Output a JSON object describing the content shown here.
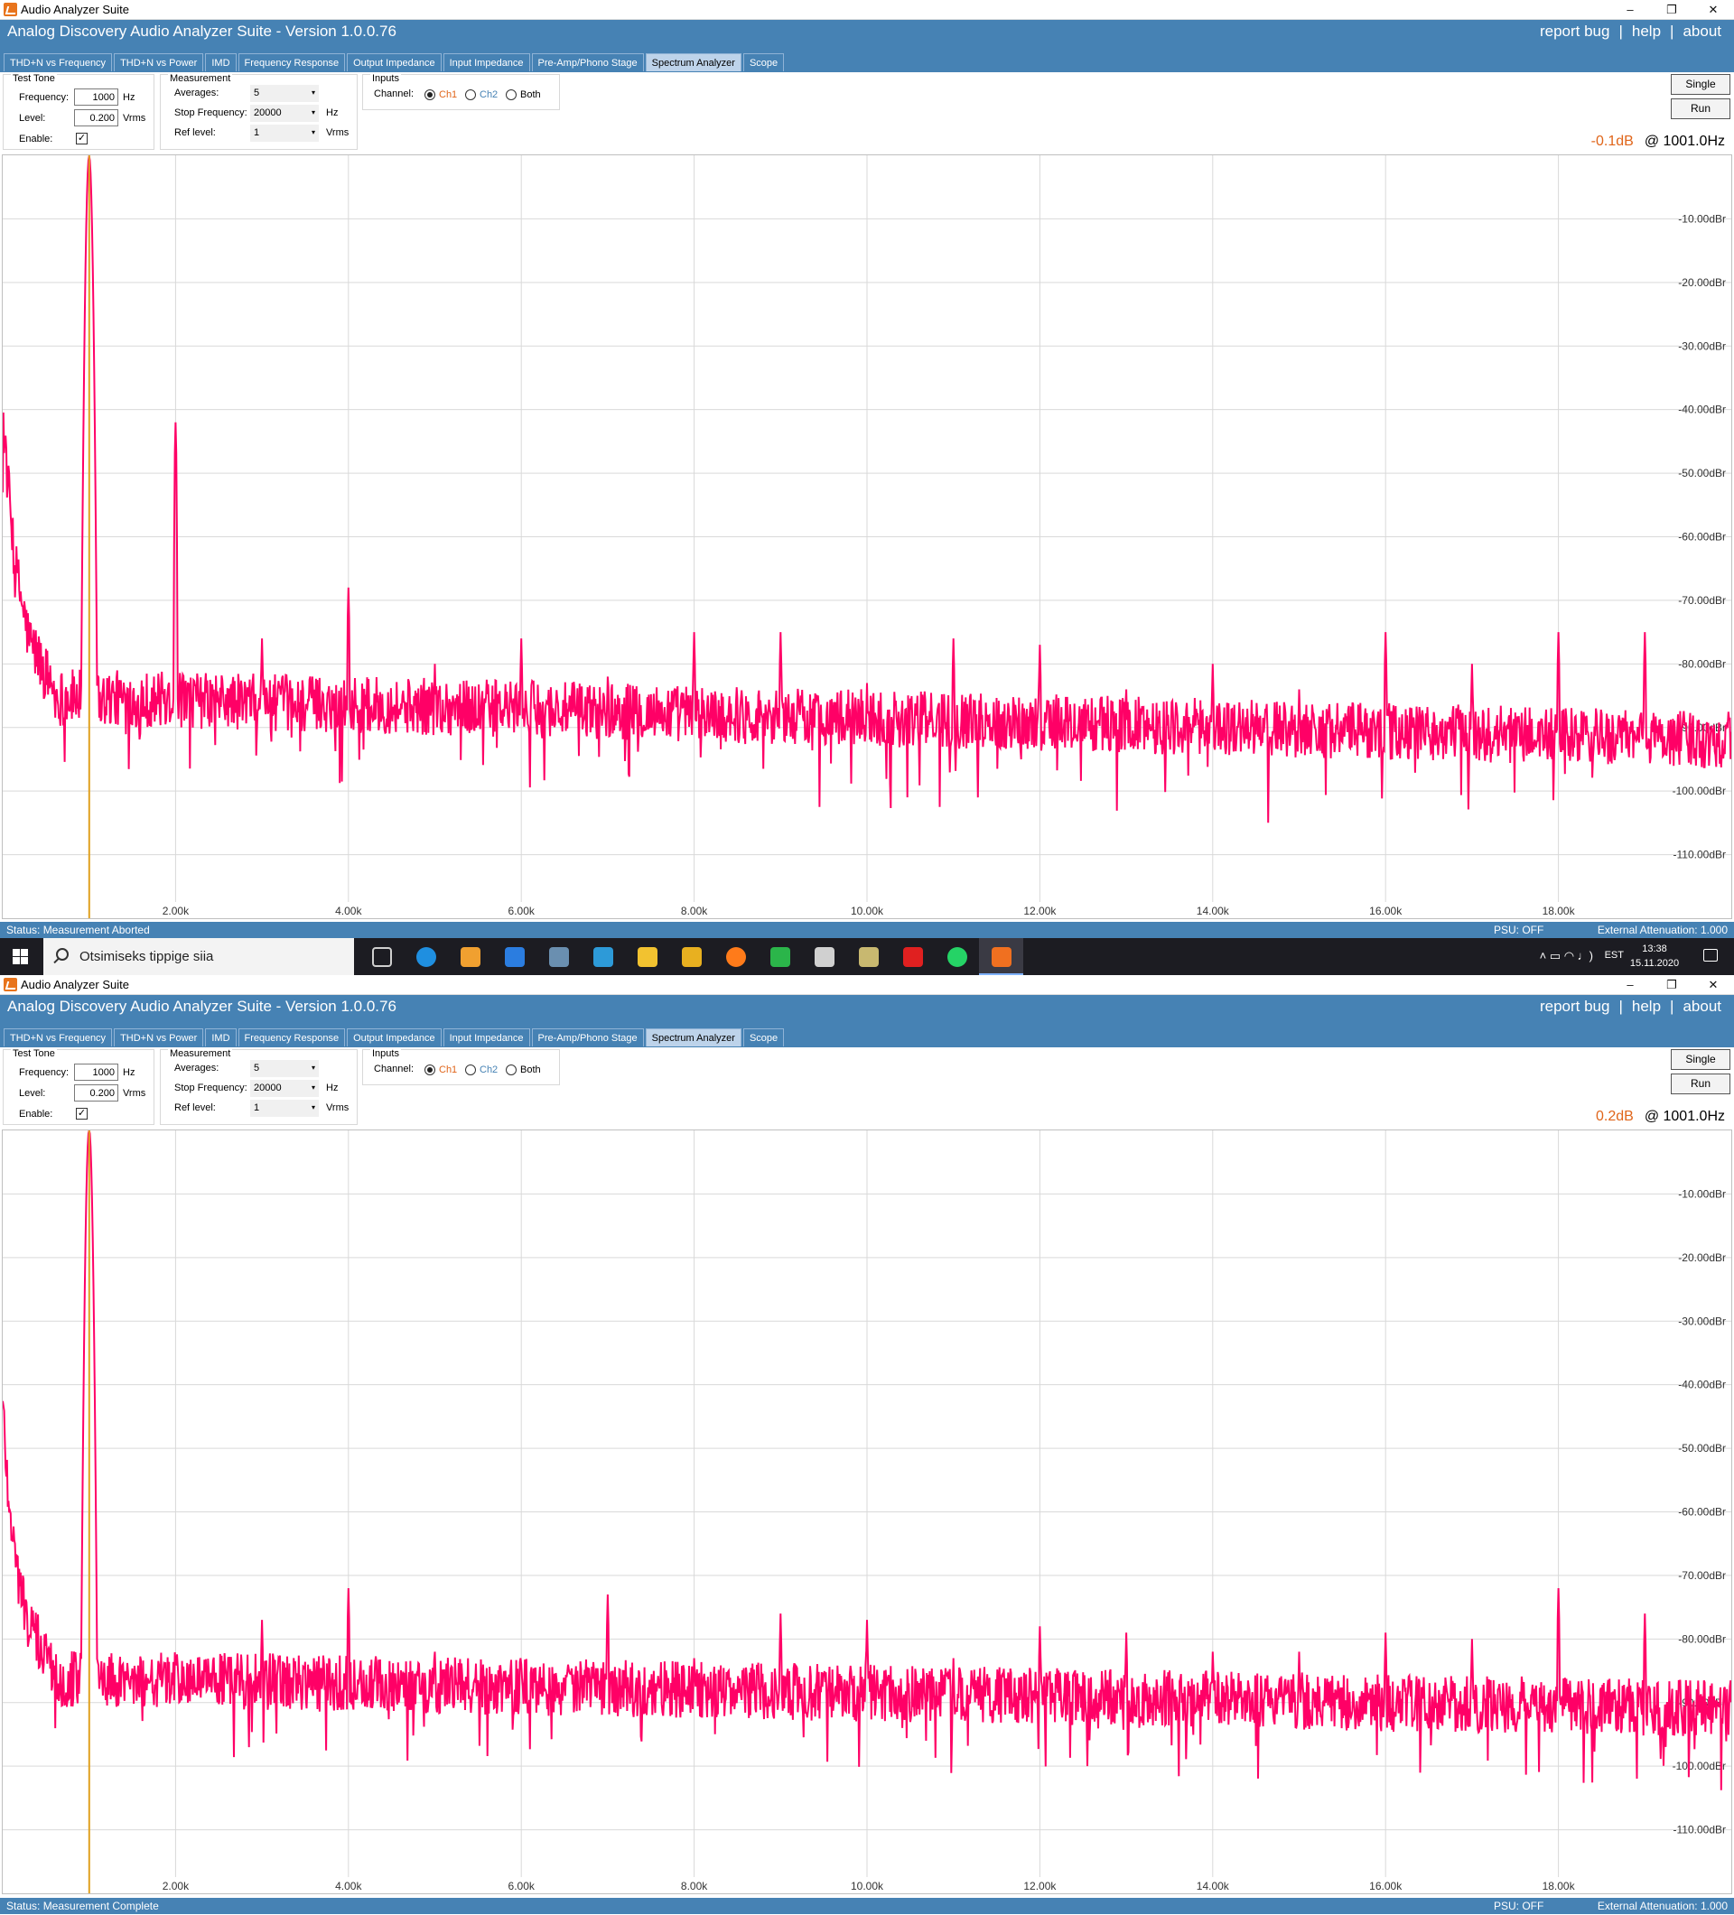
{
  "window": {
    "title": "Audio Analyzer Suite",
    "minimize": "–",
    "restore": "❐",
    "close": "✕"
  },
  "header": {
    "title": "Analog Discovery Audio Analyzer Suite - Version   1.0.0.76",
    "links": [
      "report bug",
      "help",
      "about"
    ],
    "separator": "|"
  },
  "tabs": [
    "THD+N vs Frequency",
    "THD+N vs Power",
    "IMD",
    "Frequency Response",
    "Output Impedance",
    "Input Impedance",
    "Pre-Amp/Phono Stage",
    "Spectrum Analyzer",
    "Scope"
  ],
  "active_tab": "Spectrum Analyzer",
  "test_tone": {
    "title": "Test Tone",
    "frequency_label": "Frequency:",
    "frequency_value": "1000",
    "frequency_unit": "Hz",
    "level_label": "Level:",
    "level_value": "0.200",
    "level_unit": "Vrms",
    "enable_label": "Enable:",
    "enable_checked": "✓"
  },
  "measurement": {
    "title": "Measurement",
    "averages_label": "Averages:",
    "averages_value": "5",
    "stop_label": "Stop Frequency:",
    "stop_value": "20000",
    "stop_unit": "Hz",
    "ref_label": "Ref level:",
    "ref_value": "1",
    "ref_unit": "Vrms",
    "arrow": "▾"
  },
  "inputs": {
    "title": "Inputs",
    "channel_label": "Channel:",
    "ch1": "Ch1",
    "ch2": "Ch2",
    "both": "Both",
    "selected": "Ch1"
  },
  "buttons": {
    "single": "Single",
    "run": "Run"
  },
  "colors": {
    "header": "#4682b4",
    "trace": "#ff0066",
    "marker": "#e0a020",
    "grid": "#d9d9d9",
    "readout_db": "#e0651a"
  },
  "panels": [
    {
      "readout_db": "-0.1dB",
      "readout_freq": "@ 1001.0Hz",
      "status": "Status: Measurement Aborted",
      "psu": "PSU: OFF",
      "attenuation": "External Attenuation: 1.000"
    },
    {
      "readout_db": "0.2dB",
      "readout_freq": "@ 1001.0Hz",
      "status": "Status: Measurement Complete",
      "psu": "PSU: OFF",
      "attenuation": "External Attenuation: 1.000"
    }
  ],
  "taskbar": {
    "search_placeholder": "Otsimiseks tippige siia",
    "icons": [
      "task-view-icon",
      "edge-icon",
      "store-icon",
      "mail-icon",
      "calculator-icon",
      "photos-icon",
      "file-explorer-icon",
      "paint-icon",
      "firefox-icon",
      "winamp-icon",
      "wolf-app-icon",
      "cpu-z-icon",
      "red-app-icon",
      "whatsapp-icon",
      "audio-analyzer-icon"
    ],
    "tray_glyphs": "˄  ▭  ◠  ♩)",
    "language": "EST",
    "time": "13:38",
    "date": "15.11.2020"
  },
  "chart_data": [
    {
      "type": "line",
      "title": "",
      "xlabel": "",
      "ylabel": "",
      "x_unit": "Hz",
      "xlim": [
        0,
        20000
      ],
      "ylim": [
        -120,
        0
      ],
      "x_ticks": [
        2000,
        4000,
        6000,
        8000,
        10000,
        12000,
        14000,
        16000,
        18000
      ],
      "x_tick_labels": [
        "2.00k",
        "4.00k",
        "6.00k",
        "8.00k",
        "10.00k",
        "12.00k",
        "14.00k",
        "16.00k",
        "18.00k"
      ],
      "y_ticks": [
        -10,
        -20,
        -30,
        -40,
        -50,
        -60,
        -70,
        -80,
        -90,
        -100,
        -110
      ],
      "y_tick_labels": [
        "-10.00dBr",
        "-20.00dBr",
        "-30.00dBr",
        "-40.00dBr",
        "-50.00dBr",
        "-60.00dBr",
        "-70.00dBr",
        "-80.00dBr",
        "-90.00dBr",
        "-100.00dBr",
        "-110.00dBr"
      ],
      "grid": true,
      "marker_frequency": 1001,
      "noise_floor": {
        "start_db": -85,
        "end_db": -92
      },
      "low_freq_rise": [
        [
          0,
          -40
        ],
        [
          60,
          -52
        ],
        [
          150,
          -65
        ],
        [
          300,
          -76
        ],
        [
          600,
          -84
        ]
      ],
      "peaks": [
        {
          "freq": 1000,
          "db": -0.1
        },
        {
          "freq": 2000,
          "db": -42
        },
        {
          "freq": 3000,
          "db": -76
        },
        {
          "freq": 4000,
          "db": -68
        },
        {
          "freq": 5000,
          "db": -80
        },
        {
          "freq": 6000,
          "db": -76
        },
        {
          "freq": 7000,
          "db": -82
        },
        {
          "freq": 8000,
          "db": -75
        },
        {
          "freq": 9000,
          "db": -75
        },
        {
          "freq": 10000,
          "db": -83
        },
        {
          "freq": 11000,
          "db": -76
        },
        {
          "freq": 12000,
          "db": -77
        },
        {
          "freq": 13000,
          "db": -84
        },
        {
          "freq": 14000,
          "db": -80
        },
        {
          "freq": 15000,
          "db": -84
        },
        {
          "freq": 16000,
          "db": -75
        },
        {
          "freq": 17000,
          "db": -80
        },
        {
          "freq": 18000,
          "db": -75
        },
        {
          "freq": 19000,
          "db": -75
        }
      ]
    },
    {
      "type": "line",
      "title": "",
      "xlabel": "",
      "ylabel": "",
      "x_unit": "Hz",
      "xlim": [
        0,
        20000
      ],
      "ylim": [
        -120,
        0
      ],
      "x_ticks": [
        2000,
        4000,
        6000,
        8000,
        10000,
        12000,
        14000,
        16000,
        18000
      ],
      "x_tick_labels": [
        "2.00k",
        "4.00k",
        "6.00k",
        "8.00k",
        "10.00k",
        "12.00k",
        "14.00k",
        "16.00k",
        "18.00k"
      ],
      "y_ticks": [
        -10,
        -20,
        -30,
        -40,
        -50,
        -60,
        -70,
        -80,
        -90,
        -100,
        -110
      ],
      "y_tick_labels": [
        "-10.00dBr",
        "-20.00dBr",
        "-30.00dBr",
        "-40.00dBr",
        "-50.00dBr",
        "-60.00dBr",
        "-70.00dBr",
        "-80.00dBr",
        "-90.00dBr",
        "-100.00dBr",
        "-110.00dBr"
      ],
      "grid": true,
      "marker_frequency": 1001,
      "noise_floor": {
        "start_db": -86,
        "end_db": -91
      },
      "low_freq_rise": [
        [
          0,
          -43
        ],
        [
          60,
          -56
        ],
        [
          150,
          -68
        ],
        [
          300,
          -78
        ],
        [
          600,
          -85
        ]
      ],
      "peaks": [
        {
          "freq": 1000,
          "db": 0.2
        },
        {
          "freq": 2000,
          "db": -84
        },
        {
          "freq": 3000,
          "db": -77
        },
        {
          "freq": 4000,
          "db": -72
        },
        {
          "freq": 5000,
          "db": -82
        },
        {
          "freq": 6000,
          "db": -84
        },
        {
          "freq": 7000,
          "db": -73
        },
        {
          "freq": 8000,
          "db": -83
        },
        {
          "freq": 9000,
          "db": -76
        },
        {
          "freq": 10000,
          "db": -77
        },
        {
          "freq": 11000,
          "db": -83
        },
        {
          "freq": 12000,
          "db": -78
        },
        {
          "freq": 13000,
          "db": -79
        },
        {
          "freq": 14000,
          "db": -82
        },
        {
          "freq": 15000,
          "db": -82
        },
        {
          "freq": 16000,
          "db": -79
        },
        {
          "freq": 17000,
          "db": -80
        },
        {
          "freq": 18000,
          "db": -72
        },
        {
          "freq": 19000,
          "db": -76
        }
      ]
    }
  ]
}
